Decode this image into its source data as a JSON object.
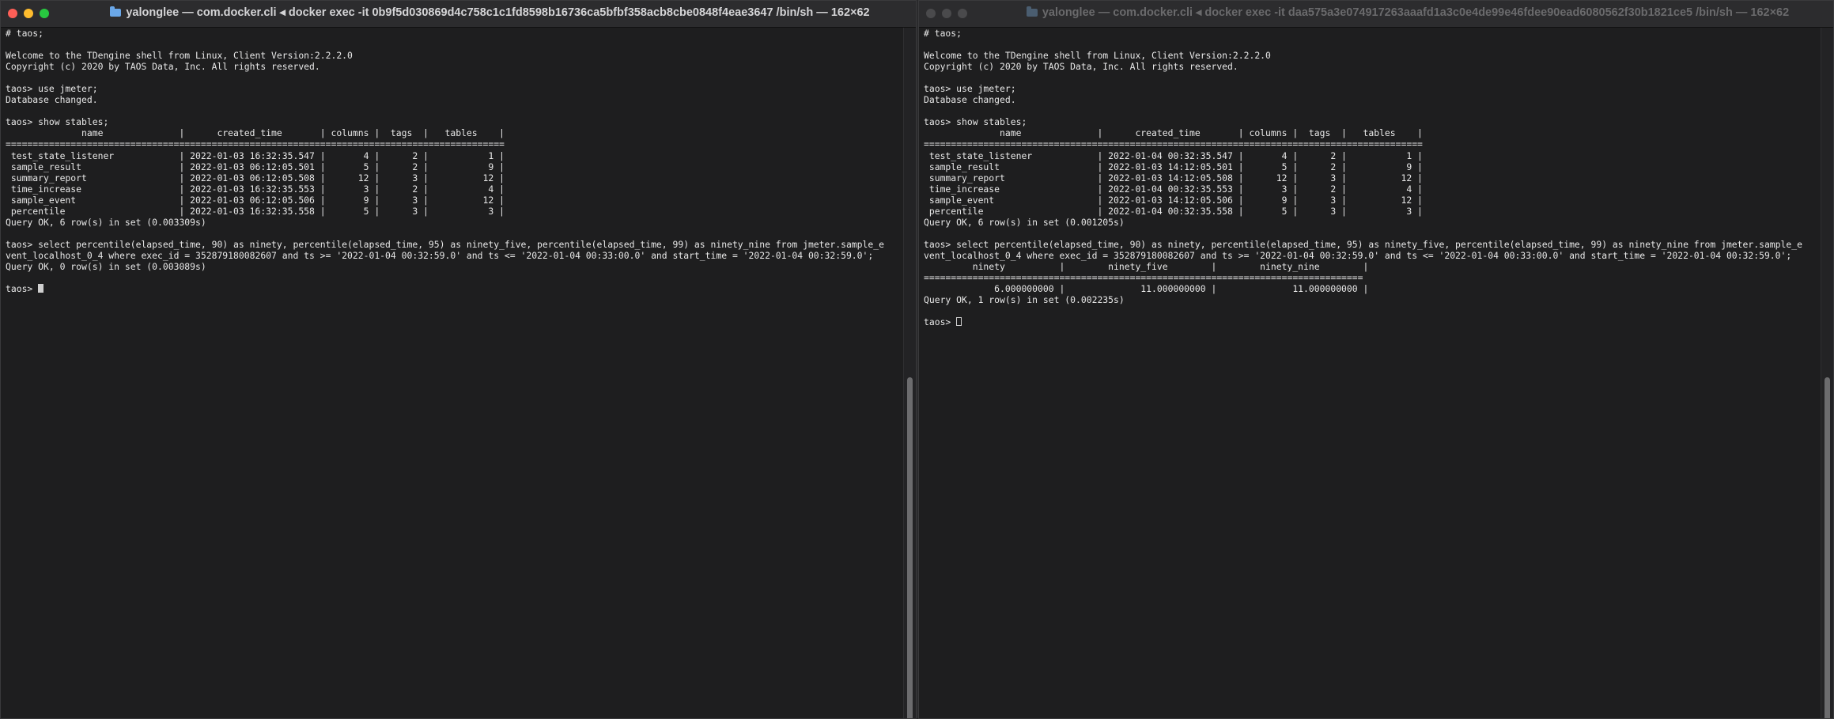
{
  "windows": {
    "left": {
      "title": "yalonglee — com.docker.cli ◂ docker exec -it 0b9f5d030869d4c758c1c1fd8598b16736ca5bfbf358acb8cbe0848f4eae3647 /bin/sh — 162×62",
      "lines": [
        "# taos;",
        "",
        "Welcome to the TDengine shell from Linux, Client Version:2.2.2.0",
        "Copyright (c) 2020 by TAOS Data, Inc. All rights reserved.",
        "",
        "taos> use jmeter;",
        "Database changed.",
        "",
        "taos> show stables;",
        "              name              |      created_time       | columns |  tags  |   tables    |",
        "============================================================================================",
        " test_state_listener            | 2022-01-03 16:32:35.547 |       4 |      2 |           1 |",
        " sample_result                  | 2022-01-03 06:12:05.501 |       5 |      2 |           9 |",
        " summary_report                 | 2022-01-03 06:12:05.508 |      12 |      3 |          12 |",
        " time_increase                  | 2022-01-03 16:32:35.553 |       3 |      2 |           4 |",
        " sample_event                   | 2022-01-03 06:12:05.506 |       9 |      3 |          12 |",
        " percentile                     | 2022-01-03 16:32:35.558 |       5 |      3 |           3 |",
        "Query OK, 6 row(s) in set (0.003309s)",
        "",
        "taos> select percentile(elapsed_time, 90) as ninety, percentile(elapsed_time, 95) as ninety_five, percentile(elapsed_time, 99) as ninety_nine from jmeter.sample_e",
        "vent_localhost_0_4 where exec_id = 352879180082607 and ts >= '2022-01-04 00:32:59.0' and ts <= '2022-01-04 00:33:00.0' and start_time = '2022-01-04 00:32:59.0';",
        "Query OK, 0 row(s) in set (0.003089s)",
        "",
        "taos> "
      ]
    },
    "right": {
      "title": "yalonglee — com.docker.cli ◂ docker exec -it daa575a3e074917263aaafd1a3c0e4de99e46fdee90ead6080562f30b1821ce5 /bin/sh — 162×62",
      "lines": [
        "# taos;",
        "",
        "Welcome to the TDengine shell from Linux, Client Version:2.2.2.0",
        "Copyright (c) 2020 by TAOS Data, Inc. All rights reserved.",
        "",
        "taos> use jmeter;",
        "Database changed.",
        "",
        "taos> show stables;",
        "              name              |      created_time       | columns |  tags  |   tables    |",
        "============================================================================================",
        " test_state_listener            | 2022-01-04 00:32:35.547 |       4 |      2 |           1 |",
        " sample_result                  | 2022-01-03 14:12:05.501 |       5 |      2 |           9 |",
        " summary_report                 | 2022-01-03 14:12:05.508 |      12 |      3 |          12 |",
        " time_increase                  | 2022-01-04 00:32:35.553 |       3 |      2 |           4 |",
        " sample_event                   | 2022-01-03 14:12:05.506 |       9 |      3 |          12 |",
        " percentile                     | 2022-01-04 00:32:35.558 |       5 |      3 |           3 |",
        "Query OK, 6 row(s) in set (0.001205s)",
        "",
        "taos> select percentile(elapsed_time, 90) as ninety, percentile(elapsed_time, 95) as ninety_five, percentile(elapsed_time, 99) as ninety_nine from jmeter.sample_e",
        "vent_localhost_0_4 where exec_id = 352879180082607 and ts >= '2022-01-04 00:32:59.0' and ts <= '2022-01-04 00:33:00.0' and start_time = '2022-01-04 00:32:59.0';",
        "         ninety          |        ninety_five        |        ninety_nine        |",
        "=================================================================================",
        "             6.000000000 |              11.000000000 |              11.000000000 |",
        "Query OK, 1 row(s) in set (0.002235s)",
        "",
        "taos> "
      ]
    }
  }
}
